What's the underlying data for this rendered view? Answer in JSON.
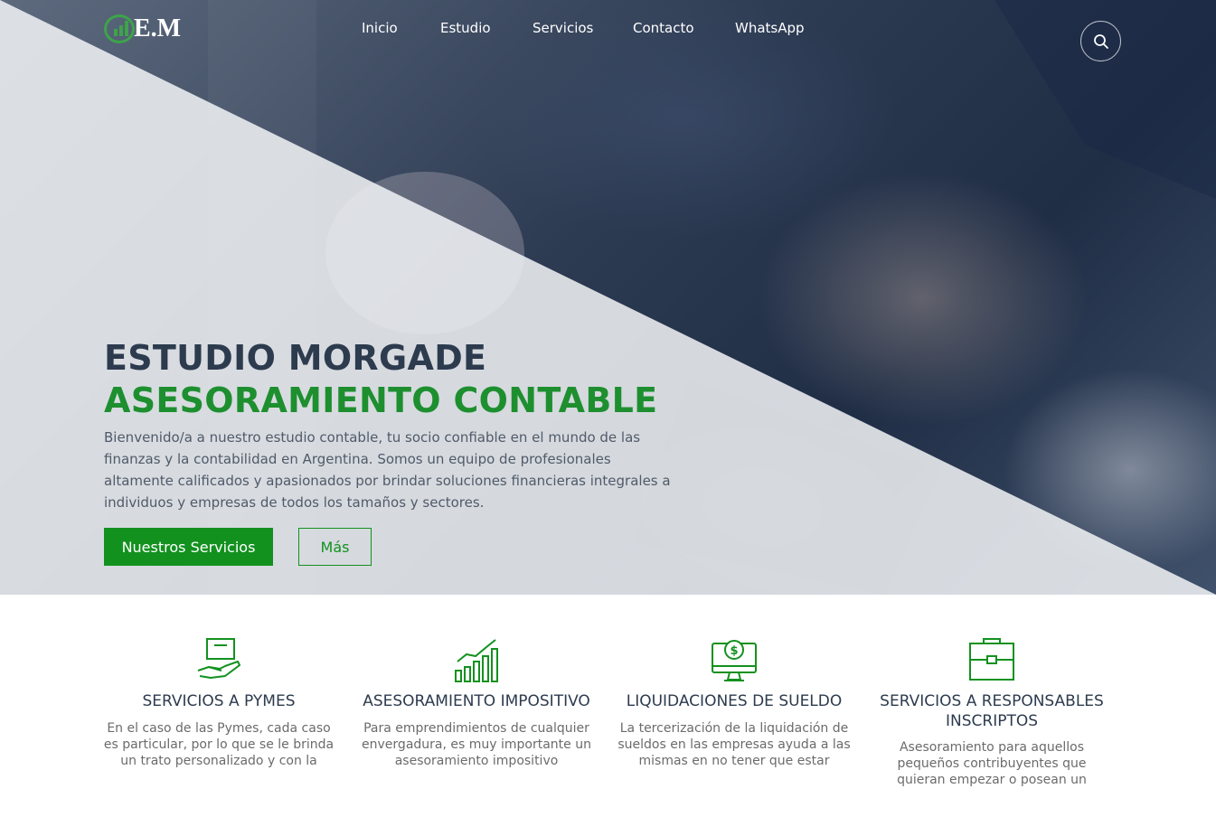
{
  "brand": {
    "logo_text": "E.M",
    "accent": "#13911f",
    "dark": "#2d3b4e"
  },
  "nav": {
    "items": [
      {
        "label": "Inicio"
      },
      {
        "label": "Estudio"
      },
      {
        "label": "Servicios"
      },
      {
        "label": "Contacto"
      },
      {
        "label": "WhatsApp"
      }
    ],
    "search_icon": "search-icon"
  },
  "hero": {
    "title": "ESTUDIO MORGADE",
    "subtitle": "ASESORAMIENTO CONTABLE",
    "description": "Bienvenido/a a nuestro estudio contable, tu socio confiable en el mundo de las finanzas y la contabilidad en Argentina. Somos un equipo de profesionales altamente calificados y apasionados por brindar soluciones financieras integrales a individuos y empresas de todos los tamaños y sectores.",
    "primary_button": "Nuestros Servicios",
    "secondary_button": "Más"
  },
  "services": [
    {
      "icon": "hand-box-icon",
      "title": "SERVICIOS A PYMES",
      "text": "En el caso de las Pymes, cada caso es particular, por lo que se le brinda un trato personalizado y con la"
    },
    {
      "icon": "growth-chart-icon",
      "title": "ASESORAMIENTO IMPOSITIVO",
      "text": "Para emprendimientos de cualquier envergadura, es muy importante un asesoramiento impositivo"
    },
    {
      "icon": "monitor-dollar-icon",
      "title": "LIQUIDACIONES DE SUELDO",
      "text": "La tercerización de la liquidación de sueldos en las empresas ayuda a las mismas en no tener que estar"
    },
    {
      "icon": "briefcase-icon",
      "title": "SERVICIOS A RESPONSABLES INSCRIPTOS",
      "text": "Asesoramiento para aquellos pequeños contribuyentes que quieran empezar o posean un"
    }
  ]
}
